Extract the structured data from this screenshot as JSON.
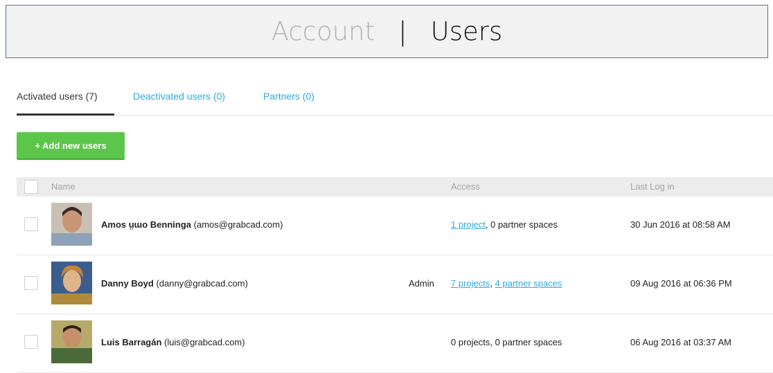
{
  "header": {
    "account": "Account",
    "separator": "|",
    "users": "Users"
  },
  "tabs": [
    {
      "label": "Activated users (7)"
    },
    {
      "label": "Deactivated users (0)"
    },
    {
      "label": "Partners (0)"
    }
  ],
  "add_button": "+ Add new users",
  "columns": {
    "name": "Name",
    "access": "Access",
    "last_login": "Last Log in"
  },
  "users": [
    {
      "name": "Amos ṳɯo Benninga",
      "email": "(amos@grabcad.com)",
      "role": "",
      "access_link1": "1 project",
      "access_sep": ", ",
      "access_link2": "",
      "access_text": "0 partner spaces",
      "last_login": "30 Jun 2016 at 08:58 AM"
    },
    {
      "name": "Danny Boyd",
      "email": "(danny@grabcad.com)",
      "role": "Admin",
      "access_link1": "7 projects",
      "access_sep": ", ",
      "access_link2": "4 partner spaces",
      "access_text": "",
      "last_login": "09 Aug 2016 at 06:36 PM"
    },
    {
      "name": "Luis Barragán",
      "email": "(luis@grabcad.com)",
      "role": "",
      "access_link1": "",
      "access_sep": "",
      "access_link2": "",
      "access_text": "0 projects, 0 partner spaces",
      "last_login": "06 Aug 2016 at 03:37 AM"
    }
  ],
  "colors": {
    "accent": "#2aa9df",
    "button": "#5cc64a"
  }
}
